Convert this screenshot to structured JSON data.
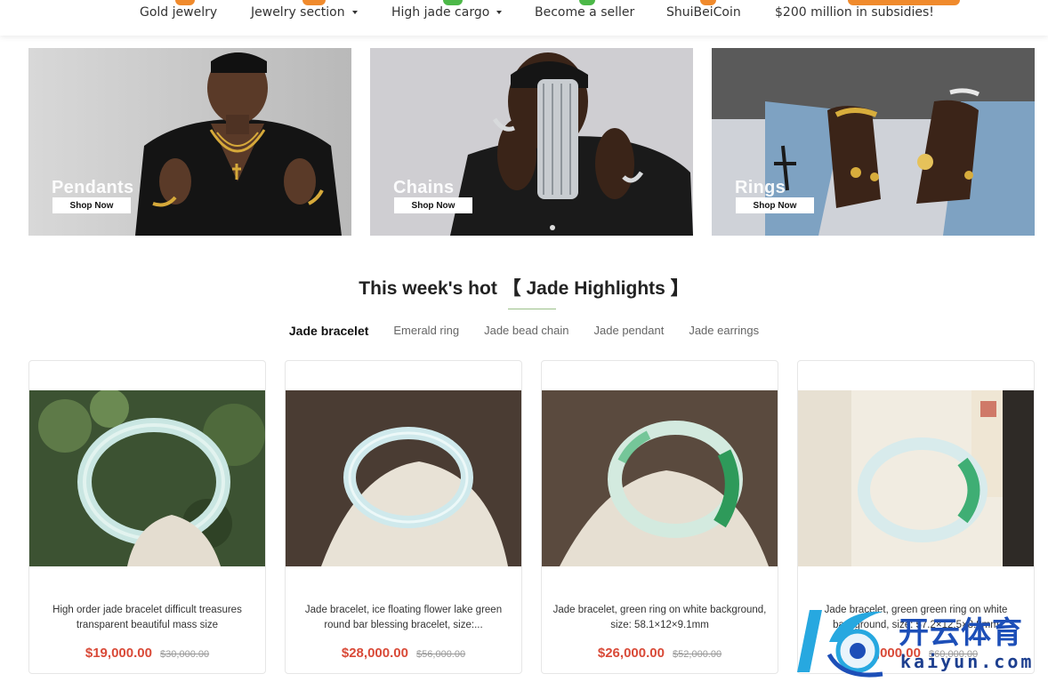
{
  "nav": {
    "items": [
      {
        "label": "Gold jewelry",
        "dropdown": false,
        "badge_color": "#f08a2c"
      },
      {
        "label": "Jewelry section",
        "dropdown": true,
        "badge_color": "#f08a2c"
      },
      {
        "label": "High jade cargo",
        "dropdown": true,
        "badge_color": "#4cb848"
      },
      {
        "label": "Become a seller",
        "dropdown": false,
        "badge_color": "#4cb848"
      },
      {
        "label": "ShuiBeiCoin",
        "dropdown": false,
        "badge_color": "#f08a2c"
      },
      {
        "label": "$200 million in subsidies!",
        "dropdown": false,
        "badge_color": "#f08a2c"
      }
    ]
  },
  "banners": [
    {
      "title": "Pendants",
      "button": "Shop Now"
    },
    {
      "title": "Chains",
      "button": "Shop Now"
    },
    {
      "title": "Rings",
      "button": "Shop Now"
    }
  ],
  "section": {
    "title": "This week's hot 【 Jade Highlights 】",
    "accent_color": "#9bc08a",
    "tabs": [
      {
        "label": "Jade bracelet",
        "active": true
      },
      {
        "label": "Emerald ring",
        "active": false
      },
      {
        "label": "Jade bead chain",
        "active": false
      },
      {
        "label": "Jade pendant",
        "active": false
      },
      {
        "label": "Jade earrings",
        "active": false
      }
    ]
  },
  "products": [
    {
      "desc": "High order jade bracelet difficult treasures transparent beautiful mass size",
      "price": "$19,000.00",
      "original": "$30,000.00"
    },
    {
      "desc": "Jade bracelet, ice floating flower lake green round bar blessing bracelet, size:...",
      "price": "$28,000.00",
      "original": "$56,000.00"
    },
    {
      "desc": "Jade bracelet, green ring on white background, size: 58.1×12×9.1mm",
      "price": "$26,000.00",
      "original": "$52,000.00"
    },
    {
      "desc": "Jade bracelet, green green ring on white background, size: 57.2×12.5×8.8mm",
      "price": "$30,000.00",
      "original": "$60,000.00"
    }
  ],
  "price_color": "#d94a38",
  "watermark": {
    "cn": "开云体育",
    "en": "kaiyun.com"
  }
}
